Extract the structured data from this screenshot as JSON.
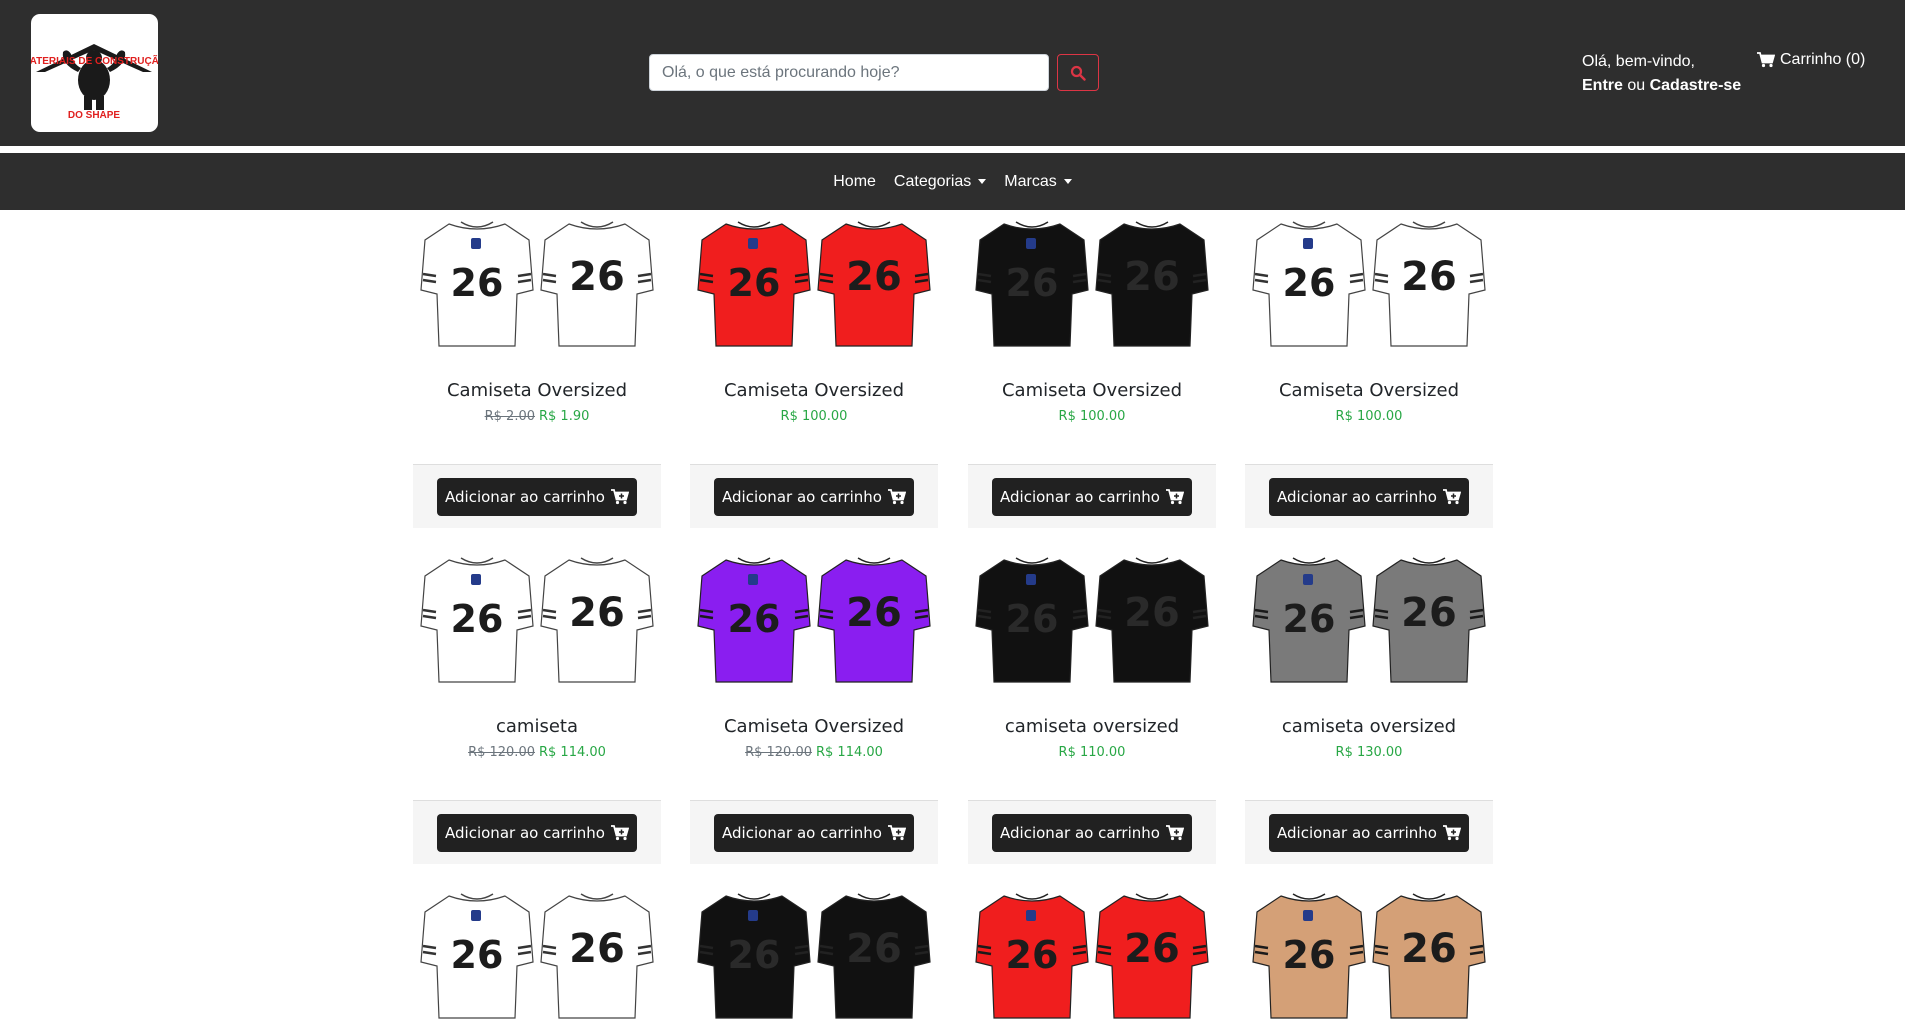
{
  "header": {
    "logo_text_top": "MATERIAIS DE CONSTRUÇÃO",
    "logo_text_bottom": "DO SHAPE",
    "search_placeholder": "Olá, o que está procurando hoje?",
    "greeting_line1": "Olá, bem-vindo,",
    "login_link": "Entre",
    "or_text": " ou ",
    "register_link": "Cadastre-se",
    "cart_label": "Carrinho (0)",
    "icons": {
      "search": "search-icon",
      "cart": "cart-icon"
    }
  },
  "nav": {
    "home": "Home",
    "categories": "Categorias",
    "brands": "Marcas"
  },
  "colors": {
    "bar": "#2e2e2e",
    "accent_red": "#dc3545",
    "price_green": "#28a745"
  },
  "products": [
    {
      "title": "Camiseta Oversized",
      "old_price": "R$ 2.00",
      "price": "R$ 1.90",
      "button": "Adicionar ao carrinho",
      "shirt_color": "#ffffff",
      "number_color": "#1c1c1c"
    },
    {
      "title": "Camiseta Oversized",
      "old_price": "",
      "price": "R$ 100.00",
      "button": "Adicionar ao carrinho",
      "shirt_color": "#f01e1e",
      "number_color": "#1c1c1c"
    },
    {
      "title": "Camiseta Oversized",
      "old_price": "",
      "price": "R$ 100.00",
      "button": "Adicionar ao carrinho",
      "shirt_color": "#111111",
      "number_color": "#2a2a2a"
    },
    {
      "title": "Camiseta Oversized",
      "old_price": "",
      "price": "R$ 100.00",
      "button": "Adicionar ao carrinho",
      "shirt_color": "#ffffff",
      "number_color": "#1c1c1c"
    },
    {
      "title": "camiseta",
      "old_price": "R$ 120.00",
      "price": "R$ 114.00",
      "button": "Adicionar ao carrinho",
      "shirt_color": "#ffffff",
      "number_color": "#1c1c1c"
    },
    {
      "title": "Camiseta Oversized",
      "old_price": "R$ 120.00",
      "price": "R$ 114.00",
      "button": "Adicionar ao carrinho",
      "shirt_color": "#8a1ef0",
      "number_color": "#1c1c1c"
    },
    {
      "title": "camiseta oversized",
      "old_price": "",
      "price": "R$ 110.00",
      "button": "Adicionar ao carrinho",
      "shirt_color": "#111111",
      "number_color": "#2a2a2a"
    },
    {
      "title": "camiseta oversized",
      "old_price": "",
      "price": "R$ 130.00",
      "button": "Adicionar ao carrinho",
      "shirt_color": "#7a7a7a",
      "number_color": "#1c1c1c"
    },
    {
      "title": "",
      "old_price": "",
      "price": "",
      "button": "",
      "shirt_color": "#ffffff",
      "number_color": "#1c1c1c"
    },
    {
      "title": "",
      "old_price": "",
      "price": "",
      "button": "",
      "shirt_color": "#111111",
      "number_color": "#2a2a2a"
    },
    {
      "title": "",
      "old_price": "",
      "price": "",
      "button": "",
      "shirt_color": "#f01e1e",
      "number_color": "#1c1c1c"
    },
    {
      "title": "",
      "old_price": "",
      "price": "",
      "button": "",
      "shirt_color": "#d4a077",
      "number_color": "#1c1c1c"
    }
  ],
  "shirt_number": "26"
}
